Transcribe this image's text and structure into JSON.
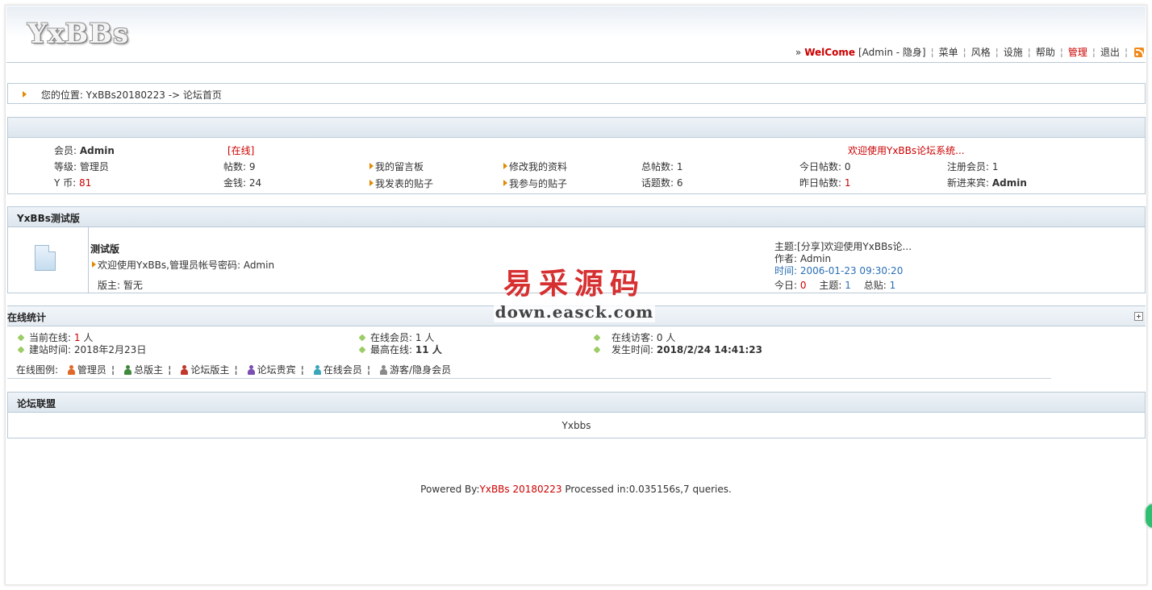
{
  "logo": "YxBBs",
  "topnav": {
    "prefix": "»",
    "welcome": "WelCome",
    "user_status": "[Admin - 隐身]",
    "items": [
      "菜单",
      "风格",
      "设施",
      "帮助"
    ],
    "admin": "管理",
    "logout": "退出",
    "rss_icon": "rss-icon"
  },
  "breadcrumb": {
    "text": "您的位置: YxBBs20180223 -> 论坛首页"
  },
  "user": {
    "member_label": "会员:",
    "member_value": "Admin",
    "online_status": "[在线]",
    "welcome_msg": "欢迎使用YxBBs论坛系统...",
    "level_label": "等级:",
    "level_value": "管理员",
    "posts_label": "帖数:",
    "posts_value": "9",
    "my_board": "我的留言板",
    "edit_profile": "修改我的资料",
    "total_posts_label": "总帖数:",
    "total_posts_value": "1",
    "today_posts_label": "今日帖数:",
    "today_posts_value": "0",
    "reg_members_label": "注册会员:",
    "reg_members_value": "1",
    "coin_label": "Y 币:",
    "coin_value": "81",
    "gold_label": "金钱:",
    "gold_value": "24",
    "my_topics": "我发表的贴子",
    "my_replies": "我参与的贴子",
    "topics_label": "话题数:",
    "topics_value": "6",
    "yesterday_label": "昨日帖数:",
    "yesterday_value": "1",
    "newest_label": "新进来宾:",
    "newest_value": "Admin"
  },
  "forum": {
    "section_title": "YxBBs测试版",
    "name": "测试版",
    "desc": "欢迎使用YxBBs,管理员帐号密码: Admin",
    "moderator": "版主: 暂无",
    "last_subject_label": "主题:",
    "last_subject": "[分享]欢迎使用YxBBs论...",
    "author_label": "作者:",
    "author": "Admin",
    "time_label": "时间:",
    "time": "2006-01-23 09:30:20",
    "today_label": "今日:",
    "today_value": "0",
    "topic_label": "主题:",
    "topic_value": "1",
    "total_label": "总贴:",
    "total_value": "1"
  },
  "online": {
    "title": "在线统计",
    "current_label": "当前在线:",
    "current_value": "1",
    "current_unit": "人",
    "members_label": "在线会员:",
    "members_value": "1 人",
    "guests_label": "在线访客:",
    "guests_value": "0 人",
    "built_label": "建站时间:",
    "built_value": "2018年2月23日",
    "max_label": "最高在线:",
    "max_value": "11 人",
    "occur_label": "发生时间:",
    "occur_value": "2018/2/24 14:41:23",
    "legend_label": "在线图例:",
    "legend": [
      {
        "name": "管理员",
        "color": "#e0692a"
      },
      {
        "name": "总版主",
        "color": "#3d8a3d"
      },
      {
        "name": "论坛版主",
        "color": "#c0392b"
      },
      {
        "name": "论坛贵宾",
        "color": "#7a4fb0"
      },
      {
        "name": "在线会员",
        "color": "#3aa6b9"
      },
      {
        "name": "游客/隐身会员",
        "color": "#8a8a8a"
      }
    ]
  },
  "links": {
    "title": "论坛联盟",
    "item": "Yxbbs"
  },
  "footer": {
    "prefix": "Powered By:",
    "product": "YxBBs 20180223",
    "suffix": "Processed in:0.035156s,7 queries."
  },
  "watermark": {
    "cn": "易采源码",
    "url": "down.easck.com"
  }
}
